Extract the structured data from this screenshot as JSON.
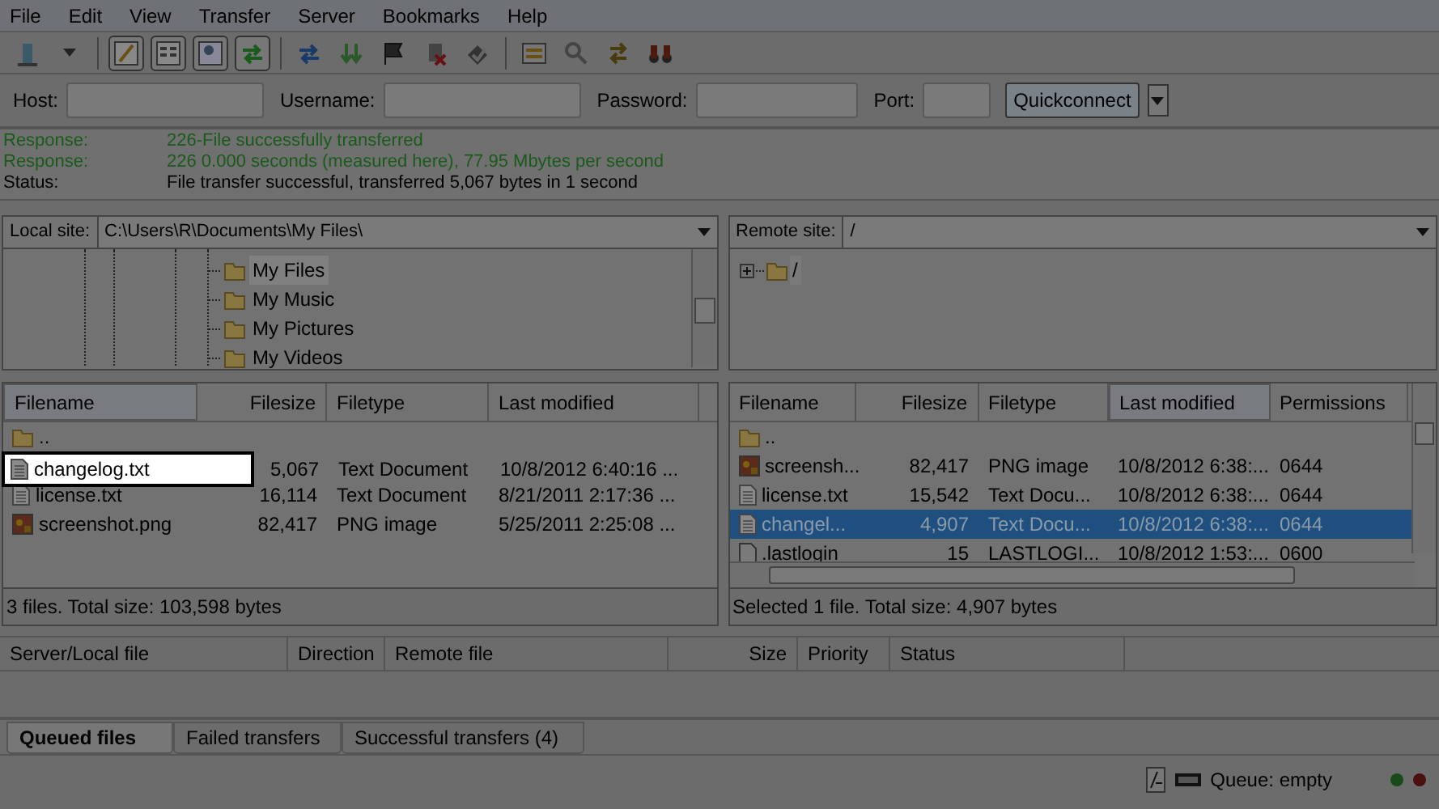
{
  "menu": [
    "File",
    "Edit",
    "View",
    "Transfer",
    "Server",
    "Bookmarks",
    "Help"
  ],
  "quickconnect": {
    "fields": [
      {
        "label": "Host:"
      },
      {
        "label": "Username:"
      },
      {
        "label": "Password:"
      },
      {
        "label": "Port:"
      }
    ],
    "button": "Quickconnect"
  },
  "log": [
    {
      "kind": "response",
      "label": "Response:",
      "message": "226-File successfully transferred"
    },
    {
      "kind": "response",
      "label": "Response:",
      "message": "226 0.000 seconds (measured here), 77.95 Mbytes per second"
    },
    {
      "kind": "status",
      "label": "Status:",
      "message": "File transfer successful, transferred 5,067 bytes in 1 second"
    }
  ],
  "local": {
    "label": "Local site:",
    "path": "C:\\Users\\R\\Documents\\My Files\\",
    "tree": [
      {
        "label": "My Files",
        "selected": true
      },
      {
        "label": "My Music",
        "selected": false
      },
      {
        "label": "My Pictures",
        "selected": false
      },
      {
        "label": "My Videos",
        "selected": false
      }
    ],
    "columns": [
      {
        "label": "Filename",
        "sorted": true
      },
      {
        "label": "Filesize",
        "sorted": false
      },
      {
        "label": "Filetype",
        "sorted": false
      },
      {
        "label": "Last modified",
        "sorted": false
      }
    ],
    "rows": [
      {
        "kind": "folder",
        "cells": [
          ".."
        ],
        "highlighted": false
      },
      {
        "kind": "text",
        "cells": [
          "changelog.txt",
          "5,067",
          "Text Document",
          "10/8/2012 6:40:16 ..."
        ],
        "highlighted": true
      },
      {
        "kind": "text",
        "cells": [
          "license.txt",
          "16,114",
          "Text Document",
          "8/21/2011 2:17:36 ..."
        ],
        "highlighted": false
      },
      {
        "kind": "image",
        "cells": [
          "screenshot.png",
          "82,417",
          "PNG image",
          "5/25/2011 2:25:08 ..."
        ],
        "highlighted": false
      }
    ],
    "status": "3 files. Total size: 103,598 bytes"
  },
  "remote": {
    "label": "Remote site:",
    "path": "/",
    "tree": [
      {
        "label": "/",
        "expanded": false
      }
    ],
    "columns": [
      {
        "label": "Filename",
        "sorted": false
      },
      {
        "label": "Filesize",
        "sorted": false
      },
      {
        "label": "Filetype",
        "sorted": false
      },
      {
        "label": "Last modified",
        "sorted": true
      },
      {
        "label": "Permissions",
        "sorted": false
      }
    ],
    "rows": [
      {
        "kind": "folder",
        "cells": [
          ".."
        ],
        "selected": false
      },
      {
        "kind": "image",
        "cells": [
          "screensh...",
          "82,417",
          "PNG image",
          "10/8/2012 6:38:...",
          "0644"
        ],
        "selected": false
      },
      {
        "kind": "text",
        "cells": [
          "license.txt",
          "15,542",
          "Text Docu...",
          "10/8/2012 6:38:...",
          "0644"
        ],
        "selected": false
      },
      {
        "kind": "text",
        "cells": [
          "changel...",
          "4,907",
          "Text Docu...",
          "10/8/2012 6:38:...",
          "0644"
        ],
        "selected": true
      },
      {
        "kind": "blank",
        "cells": [
          ".lastlogin",
          "15",
          "LASTLOGI...",
          "10/8/2012 1:53:...",
          "0600"
        ],
        "selected": false
      }
    ],
    "status": "Selected 1 file. Total size: 4,907 bytes"
  },
  "queue": {
    "columns": [
      "Server/Local file",
      "Direction",
      "Remote file",
      "Size",
      "Priority",
      "Status"
    ],
    "tabs": [
      {
        "label": "Queued files",
        "selected": true
      },
      {
        "label": "Failed transfers",
        "selected": false
      },
      {
        "label": "Successful transfers (4)",
        "selected": false
      }
    ],
    "status": "Queue: empty"
  }
}
